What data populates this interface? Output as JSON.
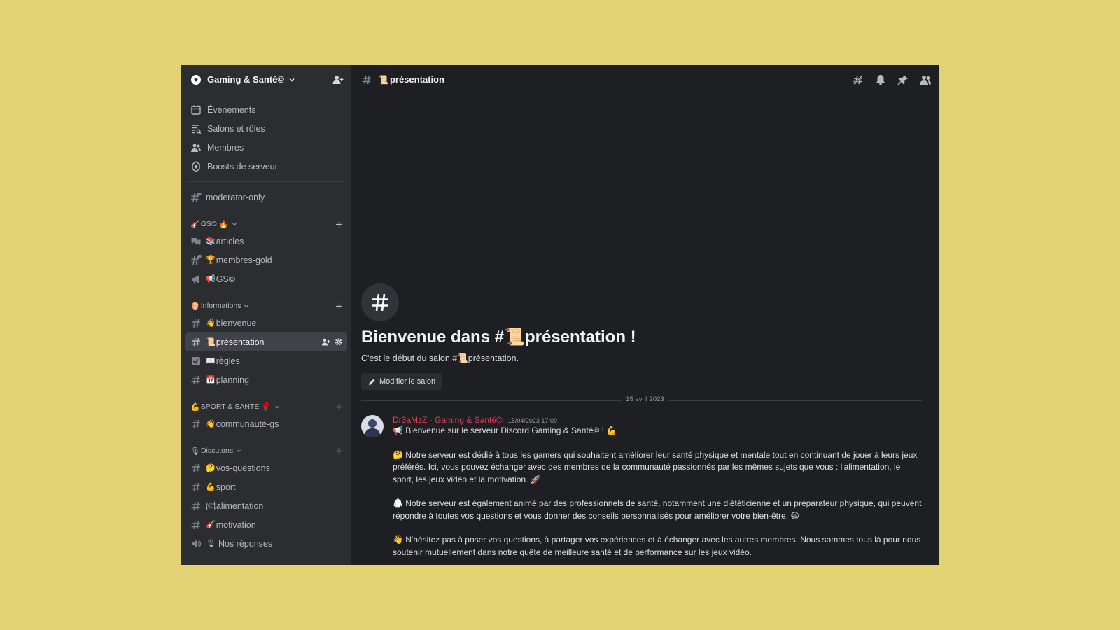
{
  "server": {
    "name": "Gaming & Santé©"
  },
  "menu": [
    {
      "label": "Événements",
      "icon": "calendar-icon"
    },
    {
      "label": "Salons et rôles",
      "icon": "channels-roles-icon"
    },
    {
      "label": "Membres",
      "icon": "members-icon"
    },
    {
      "label": "Boosts de serveur",
      "icon": "boost-icon"
    }
  ],
  "standalone_channel": {
    "label": "moderator-only"
  },
  "categories": [
    {
      "label": "GS©",
      "prefix": "🎸",
      "suffix": "🔥",
      "channels": [
        {
          "emoji": "📚",
          "label": "articles",
          "type": "forum"
        },
        {
          "emoji": "🏆",
          "label": "membres-gold",
          "type": "locked-text"
        },
        {
          "emoji": "📢",
          "label": "GS©",
          "type": "announcement"
        }
      ]
    },
    {
      "label": "Informations",
      "prefix": "🍿",
      "suffix": "",
      "channels": [
        {
          "emoji": "👋",
          "label": "bienvenue",
          "type": "text"
        },
        {
          "emoji": "📜",
          "label": "présentation",
          "type": "text",
          "active": true
        },
        {
          "emoji": "📖",
          "label": "règles",
          "type": "rules"
        },
        {
          "emoji": "📅",
          "label": "planning",
          "type": "text"
        }
      ]
    },
    {
      "label": "SPORT & SANTE",
      "prefix": "💪",
      "suffix": "🌹",
      "channels": [
        {
          "emoji": "👋",
          "label": "communauté-gs",
          "type": "text"
        }
      ]
    },
    {
      "label": "Discutons",
      "prefix": "🎙",
      "suffix": "",
      "channels": [
        {
          "emoji": "🤔",
          "label": "vos-questions",
          "type": "text"
        },
        {
          "emoji": "💪",
          "label": "sport",
          "type": "text"
        },
        {
          "emoji": "🍽",
          "label": "alimentation",
          "type": "text"
        },
        {
          "emoji": "🎸",
          "label": "motivation",
          "type": "text"
        },
        {
          "emoji": "🎙",
          "label": "Nos réponses",
          "type": "voice"
        }
      ]
    }
  ],
  "channel": {
    "title_emoji": "📜",
    "title": "présentation",
    "welcome_title": "Bienvenue dans #📜présentation !",
    "welcome_sub": "C'est le début du salon #📜présentation.",
    "edit_button": "Modifier le salon"
  },
  "date_divider": "15 avril 2023",
  "message": {
    "author": "Dr3aMzZ - Gaming & Santé©",
    "timestamp": "15/04/2023 17:09",
    "line1": "📢 Bienvenue sur le serveur Discord Gaming & Santé© ! 💪",
    "para2": "🤔 Notre serveur est dédié à tous les gamers qui souhaitent améliorer leur santé physique et mentale tout en continuant de jouer à leurs jeux préférés. Ici, vous pouvez échanger avec des membres de la communauté passionnés par les mêmes sujets que vous : l'alimentation, le sport, les jeux vidéo et la motivation. 🚀",
    "para3": "🥼 Notre serveur est également animé par des professionnels de santé, notamment une diététicienne et un préparateur physique, qui peuvent répondre à toutes vos questions et vous donner des conseils personnalisés pour améliorer votre bien-être. 😄",
    "para4": "👋 N'hésitez pas à poser vos questions, à partager vos expériences et à échanger avec les autres membres. Nous sommes tous là pour nous soutenir mutuellement dans notre quête de meilleure santé et de performance sur les jeux vidéo."
  },
  "colors": {
    "accent_author": "#e23f5d",
    "background": "#e2d274",
    "sidebar": "#2b2d31",
    "main": "#1e1f22"
  }
}
